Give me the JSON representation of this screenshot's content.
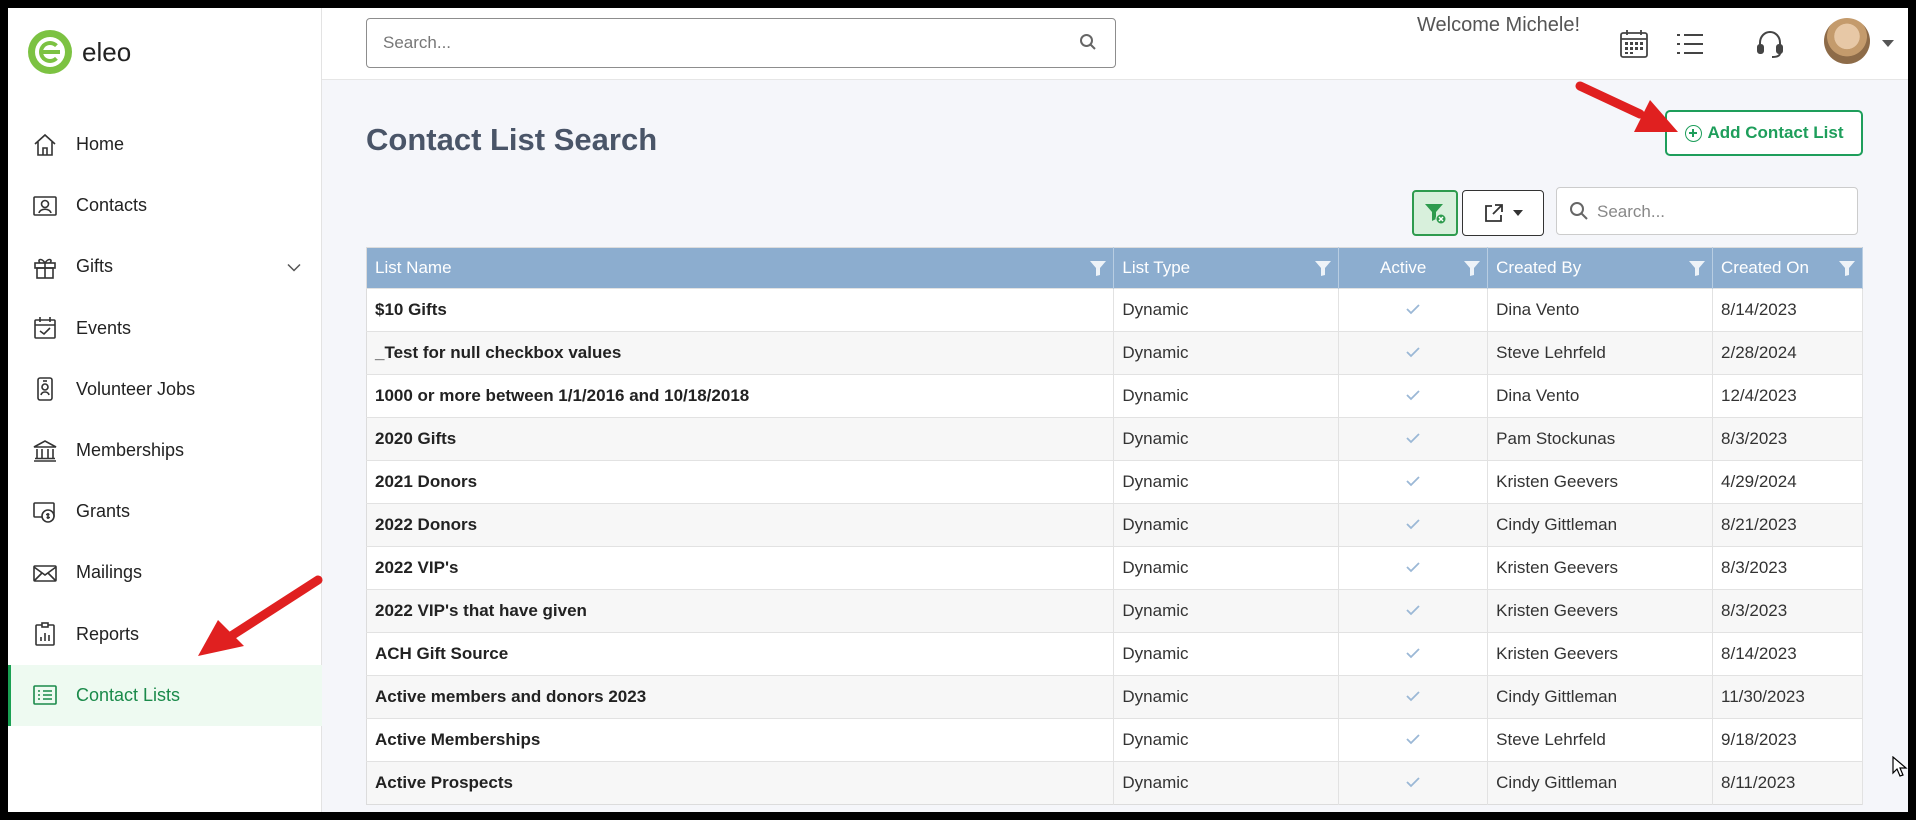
{
  "app": {
    "logo_text": "eleo",
    "brand_color": "#7cc242",
    "accent_color": "#1e9e5b"
  },
  "sidebar": {
    "items": [
      {
        "label": "Home",
        "icon": "home-icon"
      },
      {
        "label": "Contacts",
        "icon": "contact-card-icon"
      },
      {
        "label": "Gifts",
        "icon": "gift-icon",
        "expandable": true
      },
      {
        "label": "Events",
        "icon": "calendar-check-icon"
      },
      {
        "label": "Volunteer Jobs",
        "icon": "badge-icon"
      },
      {
        "label": "Memberships",
        "icon": "bank-icon"
      },
      {
        "label": "Grants",
        "icon": "grant-icon"
      },
      {
        "label": "Mailings",
        "icon": "envelope-icon"
      },
      {
        "label": "Reports",
        "icon": "report-icon"
      },
      {
        "label": "Contact Lists",
        "icon": "list-icon",
        "active": true
      }
    ]
  },
  "header": {
    "search_placeholder": "Search...",
    "welcome": "Welcome Michele!",
    "icons": [
      "calendar-grid-icon",
      "list-icon",
      "headset-icon"
    ]
  },
  "page": {
    "title": "Contact List Search",
    "add_button": "Add Contact List",
    "grid_search_placeholder": "Search..."
  },
  "table": {
    "columns": [
      "List Name",
      "List Type",
      "Active",
      "Created By",
      "Created On"
    ],
    "rows": [
      {
        "name": "$10 Gifts",
        "type": "Dynamic",
        "active": true,
        "created_by": "Dina Vento",
        "created_on": "8/14/2023"
      },
      {
        "name": "_Test for null checkbox values",
        "type": "Dynamic",
        "active": true,
        "created_by": "Steve Lehrfeld",
        "created_on": "2/28/2024"
      },
      {
        "name": "1000 or more between 1/1/2016 and 10/18/2018",
        "type": "Dynamic",
        "active": true,
        "created_by": "Dina Vento",
        "created_on": "12/4/2023"
      },
      {
        "name": "2020 Gifts",
        "type": "Dynamic",
        "active": true,
        "created_by": "Pam Stockunas",
        "created_on": "8/3/2023"
      },
      {
        "name": "2021 Donors",
        "type": "Dynamic",
        "active": true,
        "created_by": "Kristen Geevers",
        "created_on": "4/29/2024"
      },
      {
        "name": "2022 Donors",
        "type": "Dynamic",
        "active": true,
        "created_by": "Cindy Gittleman",
        "created_on": "8/21/2023"
      },
      {
        "name": "2022 VIP's",
        "type": "Dynamic",
        "active": true,
        "created_by": "Kristen Geevers",
        "created_on": "8/3/2023"
      },
      {
        "name": "2022 VIP's that have given",
        "type": "Dynamic",
        "active": true,
        "created_by": "Kristen Geevers",
        "created_on": "8/3/2023"
      },
      {
        "name": "ACH Gift Source",
        "type": "Dynamic",
        "active": true,
        "created_by": "Kristen Geevers",
        "created_on": "8/14/2023"
      },
      {
        "name": "Active members and donors 2023",
        "type": "Dynamic",
        "active": true,
        "created_by": "Cindy Gittleman",
        "created_on": "11/30/2023"
      },
      {
        "name": "Active Memberships",
        "type": "Dynamic",
        "active": true,
        "created_by": "Steve Lehrfeld",
        "created_on": "9/18/2023"
      },
      {
        "name": "Active Prospects",
        "type": "Dynamic",
        "active": true,
        "created_by": "Cindy Gittleman",
        "created_on": "8/11/2023"
      }
    ]
  }
}
